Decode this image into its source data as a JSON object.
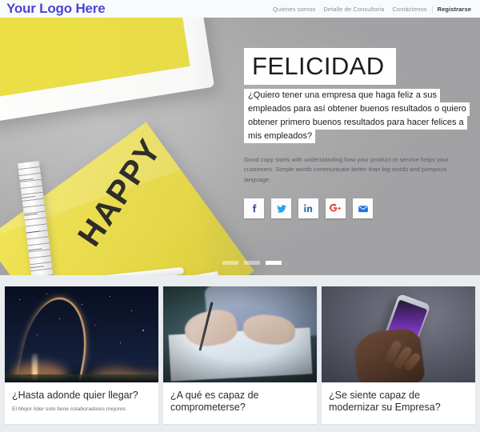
{
  "header": {
    "logo": "Your Logo Here",
    "nav": [
      {
        "label": "Quienes somos",
        "active": false
      },
      {
        "label": "Detalle de Consultoria",
        "active": false
      },
      {
        "label": "Contáctenos",
        "active": false
      },
      {
        "label": "Registrarse",
        "active": true
      }
    ]
  },
  "hero": {
    "title": "FELICIDAD",
    "paragraph_lines": [
      "¿Quiero tener una empresa que haga feliz a sus",
      "empleados para así obtener buenos resultados o quiero",
      "obtener primero buenos resultados para hacer felices a",
      "mis empleados?"
    ],
    "subtext": "Good copy starts with understanding how your product or service helps your customers. Simple words communicate better than big words and pompous language.",
    "socials": [
      {
        "name": "facebook-icon",
        "label": "f",
        "color": "#3b5998"
      },
      {
        "name": "twitter-icon",
        "label": "t",
        "color": "#2aa3ef"
      },
      {
        "name": "linkedin-icon",
        "label": "in",
        "color": "#0e76a8"
      },
      {
        "name": "google-plus-icon",
        "label": "G+",
        "color": "#db4437"
      },
      {
        "name": "email-icon",
        "label": "envelope",
        "color": "#1a73e8"
      }
    ],
    "carousel": {
      "slides": 3,
      "active_index": 2
    },
    "photo_alt": "yellow tablet, yellow HAPPY paper and ruler on grey desk"
  },
  "cards": [
    {
      "title": "¿Hasta adonde quier llegar?",
      "subtitle": "El Mejor líder solo tiene colaboradores mejores",
      "image_alt": "rocket launch arcing over the night sky"
    },
    {
      "title": "¿A qué es capaz de comprometerse?",
      "subtitle": "",
      "image_alt": "person signing a document with a pen"
    },
    {
      "title": "¿Se siente capaz de modernizar su Empresa?",
      "subtitle": "",
      "image_alt": "hand holding a smartphone with purple screen"
    }
  ],
  "colors": {
    "brand": "#4b46d6",
    "accent_yellow": "#ecdf45",
    "section_bg": "#e9edf0",
    "header_bg": "#f9fafb"
  }
}
